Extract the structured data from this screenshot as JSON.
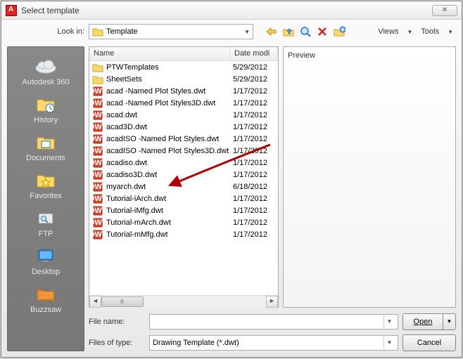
{
  "dialog": {
    "title": "Select template"
  },
  "lookin": {
    "label": "Look in:",
    "value": "Template"
  },
  "toolbar_menus": {
    "views": "Views",
    "tools": "Tools"
  },
  "places": [
    {
      "key": "autodesk360",
      "label": "Autodesk 360",
      "icon": "cloud"
    },
    {
      "key": "history",
      "label": "History",
      "icon": "history"
    },
    {
      "key": "documents",
      "label": "Documents",
      "icon": "folder"
    },
    {
      "key": "favorites",
      "label": "Favorites",
      "icon": "star"
    },
    {
      "key": "ftp",
      "label": "FTP",
      "icon": "ftp"
    },
    {
      "key": "desktop",
      "label": "Desktop",
      "icon": "desktop"
    },
    {
      "key": "buzzsaw",
      "label": "Buzzsaw",
      "icon": "buzzsaw"
    }
  ],
  "columns": {
    "name": "Name",
    "date": "Date modi"
  },
  "files": [
    {
      "name": "PTWTemplates",
      "date": "5/29/2012",
      "type": "folder"
    },
    {
      "name": "SheetSets",
      "date": "5/29/2012",
      "type": "folder"
    },
    {
      "name": "acad -Named Plot Styles.dwt",
      "date": "1/17/2012",
      "type": "dwt"
    },
    {
      "name": "acad -Named Plot Styles3D.dwt",
      "date": "1/17/2012",
      "type": "dwt"
    },
    {
      "name": "acad.dwt",
      "date": "1/17/2012",
      "type": "dwt"
    },
    {
      "name": "acad3D.dwt",
      "date": "1/17/2012",
      "type": "dwt"
    },
    {
      "name": "acadISO -Named Plot Styles.dwt",
      "date": "1/17/2012",
      "type": "dwt"
    },
    {
      "name": "acadISO -Named Plot Styles3D.dwt",
      "date": "1/17/2012",
      "type": "dwt"
    },
    {
      "name": "acadiso.dwt",
      "date": "1/17/2012",
      "type": "dwt"
    },
    {
      "name": "acadiso3D.dwt",
      "date": "1/17/2012",
      "type": "dwt"
    },
    {
      "name": "myarch.dwt",
      "date": "6/18/2012",
      "type": "dwt"
    },
    {
      "name": "Tutorial-iArch.dwt",
      "date": "1/17/2012",
      "type": "dwt"
    },
    {
      "name": "Tutorial-iMfg.dwt",
      "date": "1/17/2012",
      "type": "dwt"
    },
    {
      "name": "Tutorial-mArch.dwt",
      "date": "1/17/2012",
      "type": "dwt"
    },
    {
      "name": "Tutorial-mMfg.dwt",
      "date": "1/17/2012",
      "type": "dwt"
    }
  ],
  "preview": {
    "label": "Preview"
  },
  "filename": {
    "label": "File name:",
    "value": ""
  },
  "filetype": {
    "label": "Files of type:",
    "value": "Drawing Template (*.dwt)"
  },
  "buttons": {
    "open": "Open",
    "cancel": "Cancel"
  }
}
